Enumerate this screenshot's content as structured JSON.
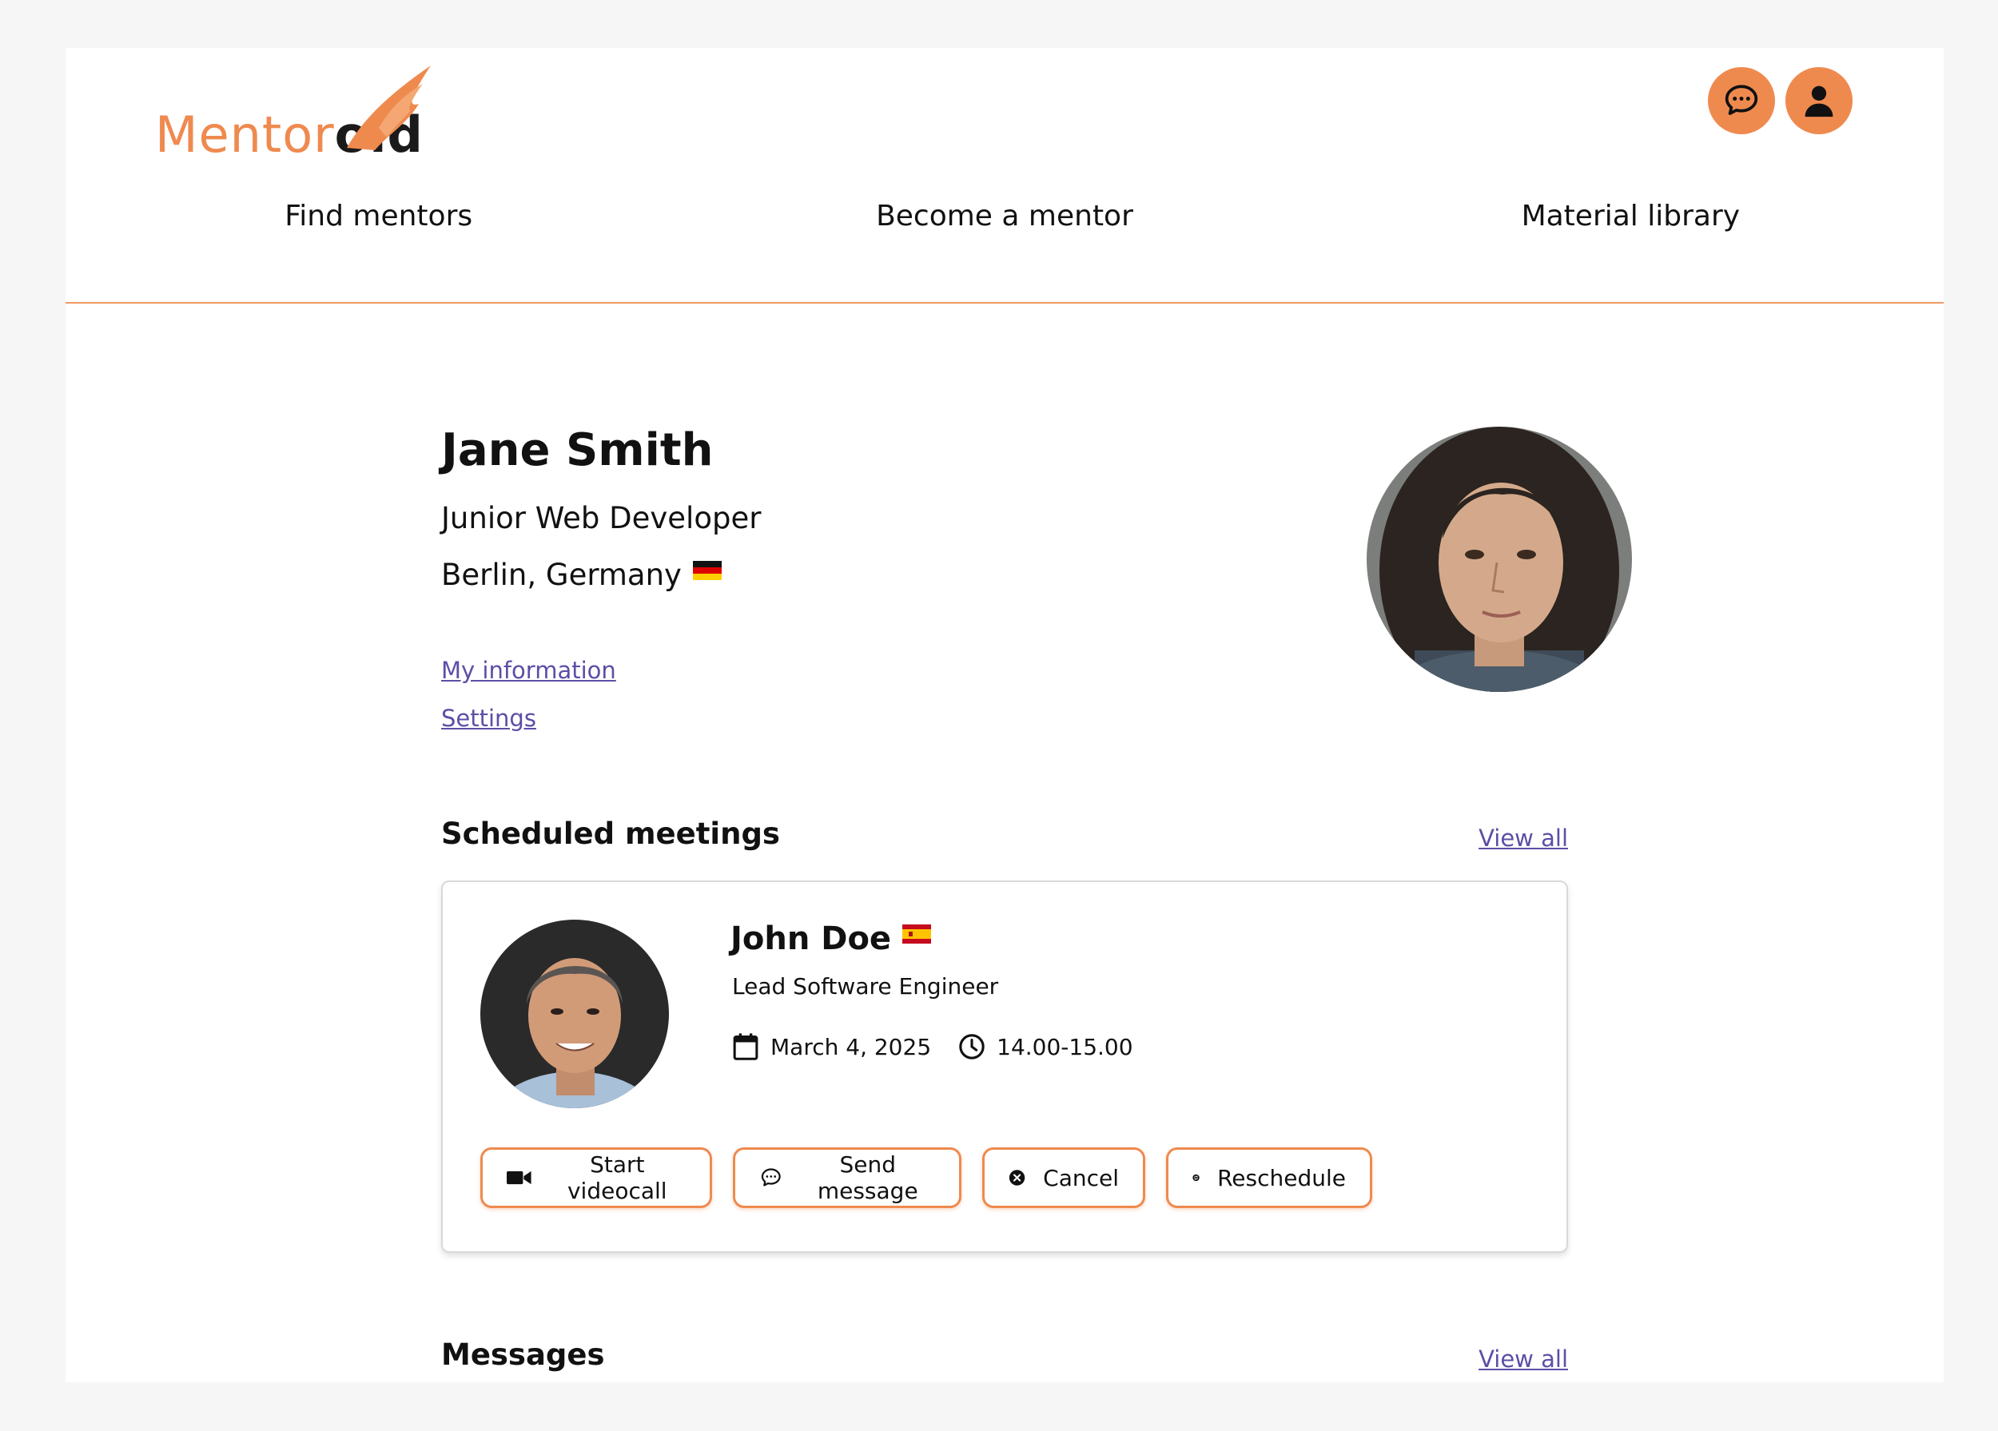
{
  "brand": {
    "logo_part1": "Mentor",
    "logo_part2": "oid",
    "accent_color": "#ef8a4f"
  },
  "header": {
    "chat_icon": "chat-bubble-icon",
    "user_icon": "user-icon"
  },
  "nav": {
    "items": [
      {
        "label": "Find mentors"
      },
      {
        "label": "Become a mentor"
      },
      {
        "label": "Material library"
      }
    ]
  },
  "profile": {
    "name": "Jane Smith",
    "title": "Junior Web Developer",
    "location": "Berlin, Germany",
    "flag_icon": "germany-flag-icon",
    "links": {
      "info": "My information",
      "settings": "Settings"
    }
  },
  "scheduled_meetings": {
    "title": "Scheduled meetings",
    "view_all": "View all",
    "meeting": {
      "name": "John Doe",
      "flag_icon": "spain-flag-icon",
      "role": "Lead Software Engineer",
      "date": "March 4, 2025",
      "time": "14.00-15.00",
      "buttons": {
        "videocall": "Start videocall",
        "message": "Send message",
        "cancel": "Cancel",
        "reschedule": "Reschedule"
      }
    }
  },
  "messages": {
    "title": "Messages",
    "view_all": "View all"
  }
}
